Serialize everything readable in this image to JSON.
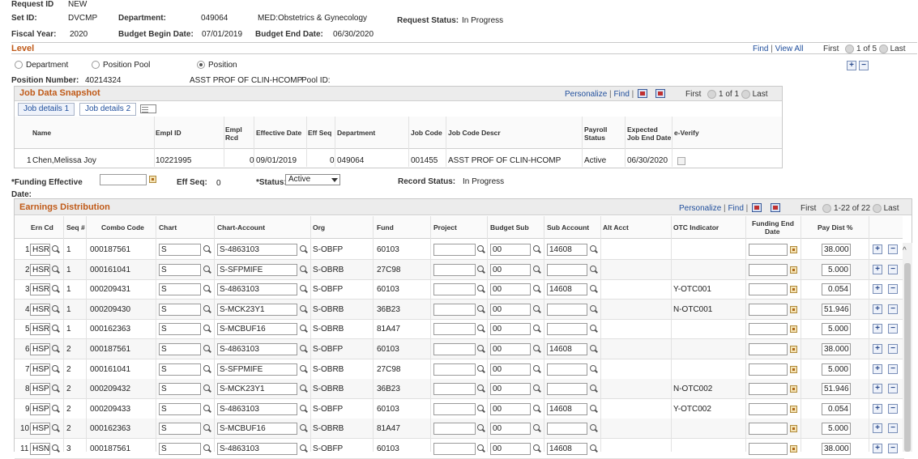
{
  "header": {
    "request_id_label": "Request ID",
    "request_id_value": "NEW",
    "setid_label": "Set ID:",
    "setid_value": "DVCMP",
    "department_label": "Department:",
    "department_code": "049064",
    "department_name": "MED:Obstetrics & Gynecology",
    "request_status_label": "Request Status:",
    "request_status_value": "In Progress",
    "fiscal_year_label": "Fiscal Year:",
    "fiscal_year_value": "2020",
    "budget_begin_label": "Budget Begin Date:",
    "budget_begin_value": "07/01/2019",
    "budget_end_label": "Budget End Date:",
    "budget_end_value": "06/30/2020"
  },
  "level": {
    "title": "Level",
    "find": "Find",
    "sep": "|",
    "view_all": "View All",
    "first": "First",
    "count": "1 of 5",
    "last": "Last",
    "add": "+",
    "remove": "−",
    "radio_department": "Department",
    "radio_position_pool": "Position Pool",
    "radio_position": "Position",
    "position_number_label": "Position Number:",
    "position_number_value": "40214324",
    "position_descr": "ASST PROF OF CLIN-HCOMP",
    "pool_id_label": "Pool ID:"
  },
  "job_snapshot": {
    "title": "Job Data Snapshot",
    "personalize": "Personalize",
    "find": "Find",
    "sep": "|",
    "first": "First",
    "count": "1 of 1",
    "last": "Last",
    "tab1": "Job details 1",
    "tab2": "Job details 2",
    "columns": {
      "name": "Name",
      "emplid": "Empl ID",
      "empl_rcd_1": "Empl",
      "empl_rcd_2": "Rcd",
      "eff_date": "Effective Date",
      "eff_seq": "Eff Seq",
      "department": "Department",
      "job_code": "Job Code",
      "job_code_descr": "Job Code Descr",
      "payroll_1": "Payroll",
      "payroll_2": "Status",
      "expected_1": "Expected",
      "expected_2": "Job End Date",
      "everify": "e-Verify"
    },
    "row": {
      "num": "1",
      "name": "Chen,Melissa Joy",
      "emplid": "10221995",
      "empl_rcd": "0",
      "eff_date": "09/01/2019",
      "eff_seq": "0",
      "department": "049064",
      "job_code": "001455",
      "job_code_descr": "ASST PROF OF CLIN-HCOMP",
      "payroll_status": "Active",
      "expected_end": "06/30/2020"
    }
  },
  "funding": {
    "eff_label_1": "*Funding Effective",
    "eff_label_2": "Date:",
    "eff_seq_label": "Eff Seq:",
    "eff_seq_value": "0",
    "status_label": "*Status:",
    "status_value": "Active",
    "record_status_label": "Record Status:",
    "record_status_value": "In Progress"
  },
  "earnings": {
    "title": "Earnings Distribution",
    "personalize": "Personalize",
    "find": "Find",
    "sep": "|",
    "first": "First",
    "count": "1-22 of 22",
    "last": "Last",
    "columns": {
      "ern_cd": "Ern Cd",
      "seq": "Seq #",
      "combo": "Combo Code",
      "chart": "Chart",
      "chart_account": "Chart-Account",
      "org": "Org",
      "fund": "Fund",
      "project": "Project",
      "budget_sub": "Budget Sub",
      "sub_account": "Sub Account",
      "alt_acct": "Alt Acct",
      "otc": "OTC Indicator",
      "funding_end_1": "Funding End",
      "funding_end_2": "Date",
      "pay_dist": "Pay Dist %"
    },
    "rows": [
      {
        "num": "1",
        "ern": "HSR",
        "seq": "1",
        "combo": "000187561",
        "chart": "S",
        "chart_account": "S-4863103",
        "org": "S-OBFP",
        "fund": "60103",
        "budget_sub": "00",
        "sub_account": "14608",
        "otc": "",
        "pay": "38.000"
      },
      {
        "num": "2",
        "ern": "HSR",
        "seq": "1",
        "combo": "000161041",
        "chart": "S",
        "chart_account": "S-SFPMIFE",
        "org": "S-OBRB",
        "fund": "27C98",
        "budget_sub": "00",
        "sub_account": "",
        "otc": "",
        "pay": "5.000"
      },
      {
        "num": "3",
        "ern": "HSR",
        "seq": "1",
        "combo": "000209431",
        "chart": "S",
        "chart_account": "S-4863103",
        "org": "S-OBFP",
        "fund": "60103",
        "budget_sub": "00",
        "sub_account": "14608",
        "otc": "Y-OTC001",
        "pay": "0.054"
      },
      {
        "num": "4",
        "ern": "HSR",
        "seq": "1",
        "combo": "000209430",
        "chart": "S",
        "chart_account": "S-MCK23Y1",
        "org": "S-OBRB",
        "fund": "36B23",
        "budget_sub": "00",
        "sub_account": "",
        "otc": "N-OTC001",
        "pay": "51.946"
      },
      {
        "num": "5",
        "ern": "HSR",
        "seq": "1",
        "combo": "000162363",
        "chart": "S",
        "chart_account": "S-MCBUF16",
        "org": "S-OBRB",
        "fund": "81A47",
        "budget_sub": "00",
        "sub_account": "",
        "otc": "",
        "pay": "5.000"
      },
      {
        "num": "6",
        "ern": "HSP",
        "seq": "2",
        "combo": "000187561",
        "chart": "S",
        "chart_account": "S-4863103",
        "org": "S-OBFP",
        "fund": "60103",
        "budget_sub": "00",
        "sub_account": "14608",
        "otc": "",
        "pay": "38.000"
      },
      {
        "num": "7",
        "ern": "HSP",
        "seq": "2",
        "combo": "000161041",
        "chart": "S",
        "chart_account": "S-SFPMIFE",
        "org": "S-OBRB",
        "fund": "27C98",
        "budget_sub": "00",
        "sub_account": "",
        "otc": "",
        "pay": "5.000"
      },
      {
        "num": "8",
        "ern": "HSP",
        "seq": "2",
        "combo": "000209432",
        "chart": "S",
        "chart_account": "S-MCK23Y1",
        "org": "S-OBRB",
        "fund": "36B23",
        "budget_sub": "00",
        "sub_account": "",
        "otc": "N-OTC002",
        "pay": "51.946"
      },
      {
        "num": "9",
        "ern": "HSP",
        "seq": "2",
        "combo": "000209433",
        "chart": "S",
        "chart_account": "S-4863103",
        "org": "S-OBFP",
        "fund": "60103",
        "budget_sub": "00",
        "sub_account": "14608",
        "otc": "Y-OTC002",
        "pay": "0.054"
      },
      {
        "num": "10",
        "ern": "HSP",
        "seq": "2",
        "combo": "000162363",
        "chart": "S",
        "chart_account": "S-MCBUF16",
        "org": "S-OBRB",
        "fund": "81A47",
        "budget_sub": "00",
        "sub_account": "",
        "otc": "",
        "pay": "5.000"
      },
      {
        "num": "11",
        "ern": "HSN",
        "seq": "3",
        "combo": "000187561",
        "chart": "S",
        "chart_account": "S-4863103",
        "org": "S-OBFP",
        "fund": "60103",
        "budget_sub": "00",
        "sub_account": "14608",
        "otc": "",
        "pay": "38.000"
      }
    ]
  }
}
